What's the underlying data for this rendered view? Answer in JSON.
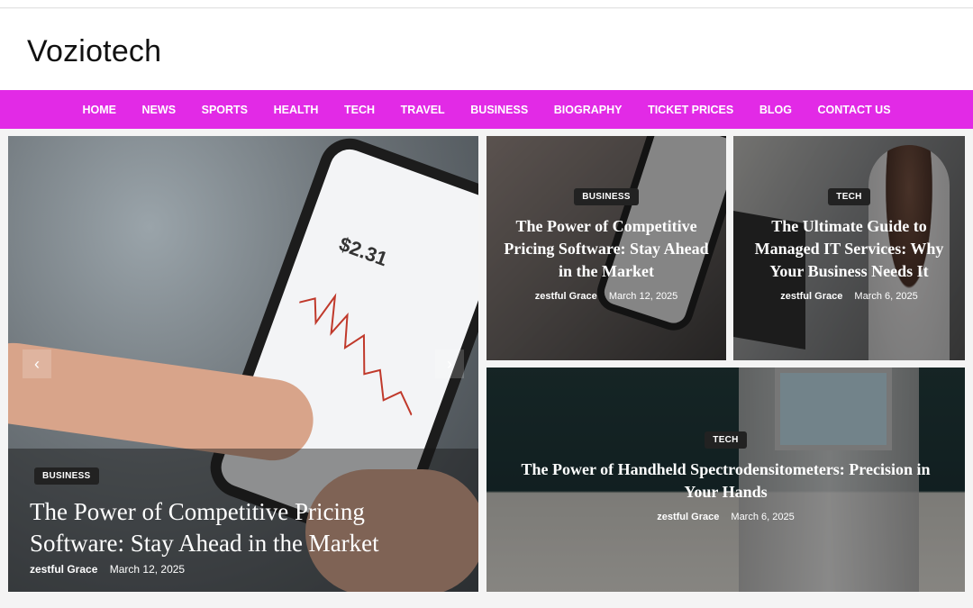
{
  "site": {
    "title": "Voziotech"
  },
  "nav": {
    "items": [
      "HOME",
      "NEWS",
      "SPORTS",
      "HEALTH",
      "TECH",
      "TRAVEL",
      "BUSINESS",
      "BIOGRAPHY",
      "TICKET PRICES",
      "BLOG",
      "CONTACT US"
    ]
  },
  "colors": {
    "nav_bg": "#e22ae6",
    "badge_bg": "#222222"
  },
  "featured": {
    "category": "BUSINESS",
    "title": "The Power of Competitive Pricing Software: Stay Ahead in the Market",
    "author": "zestful Grace",
    "date": "March 12, 2025",
    "phone_price": "$2.31",
    "prev_icon": "chevron-left-icon",
    "next_icon": "chevron-right-icon"
  },
  "posts": [
    {
      "category": "BUSINESS",
      "title": "The Power of Competitive Pricing Software: Stay Ahead in the Market",
      "author": "zestful Grace",
      "date": "March 12, 2025"
    },
    {
      "category": "TECH",
      "title": "The Ultimate Guide to Managed IT Services: Why Your Business Needs It",
      "author": "zestful Grace",
      "date": "March 6, 2025"
    },
    {
      "category": "TECH",
      "title": "The Power of Handheld Spectrodensitometers: Precision in Your Hands",
      "author": "zestful Grace",
      "date": "March 6, 2025"
    }
  ]
}
